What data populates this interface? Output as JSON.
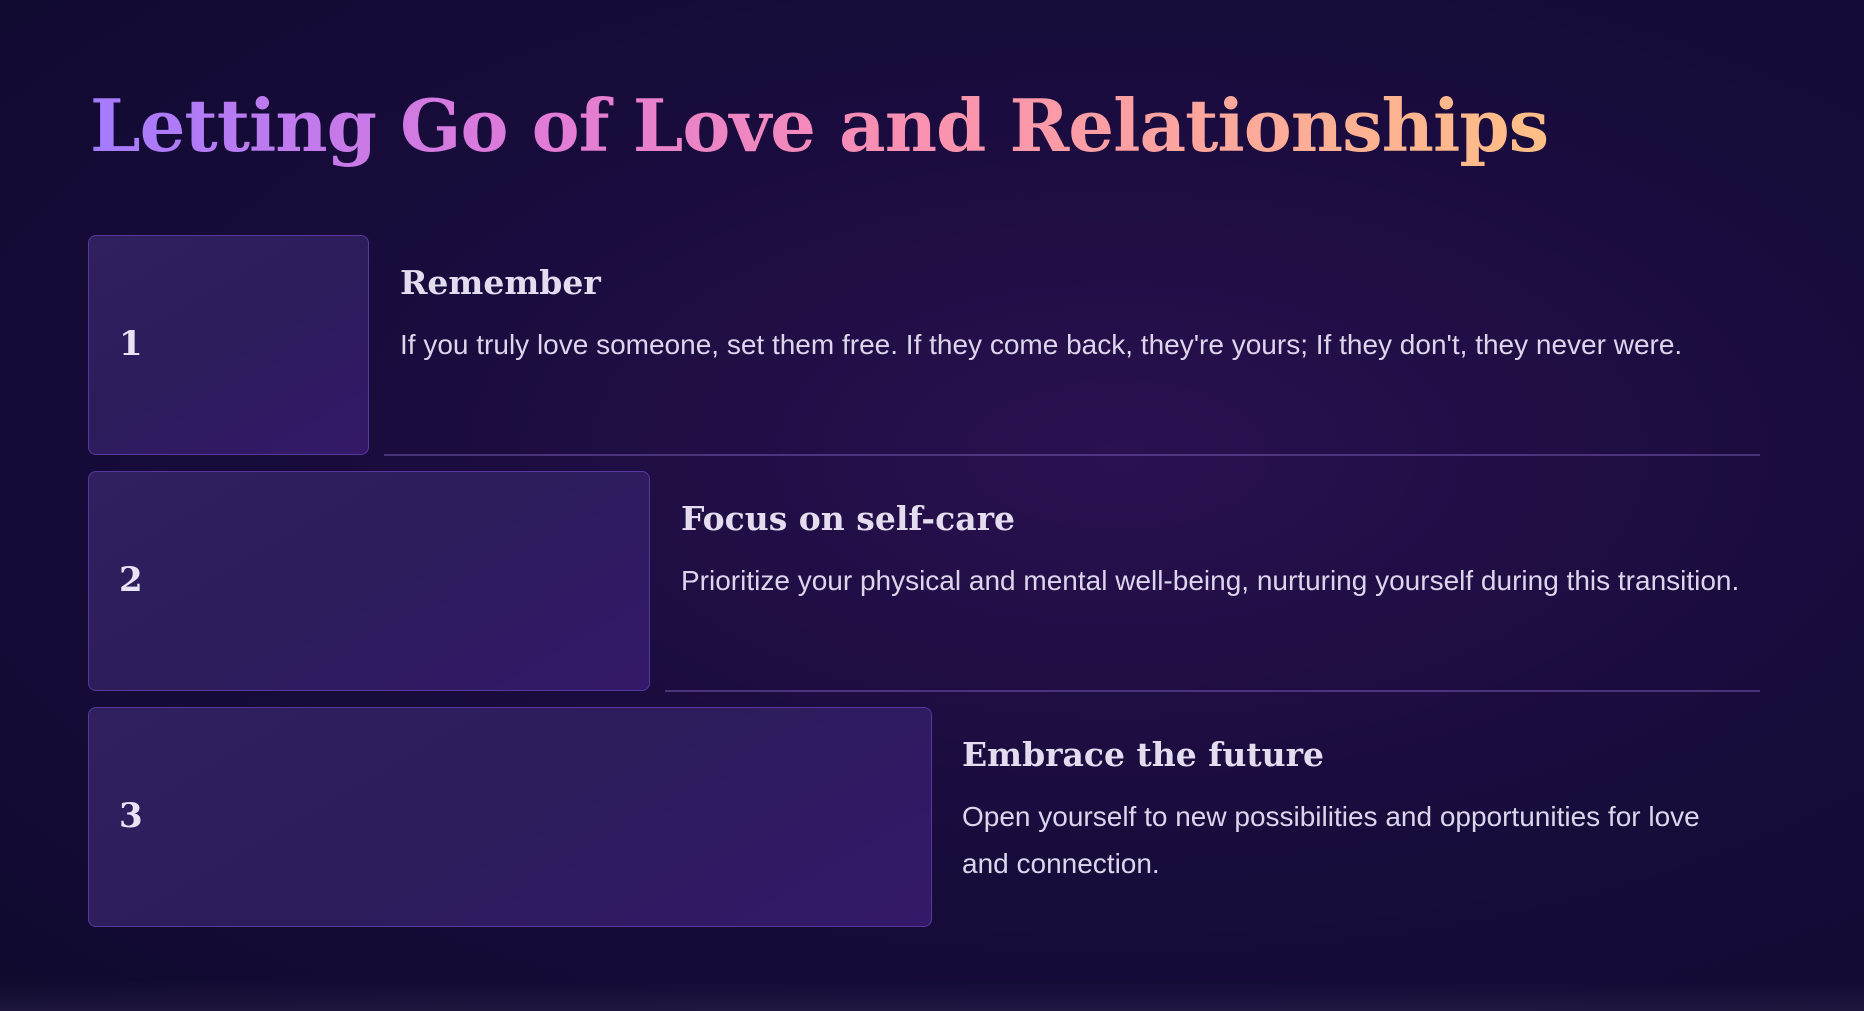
{
  "slide": {
    "title": "Letting Go of Love and Relationships",
    "steps": [
      {
        "number": "1",
        "heading": "Remember",
        "body": "If you truly love someone, set them free. If they come back, they're yours; If they don't, they never were."
      },
      {
        "number": "2",
        "heading": "Focus on self-care",
        "body": "Prioritize your physical and mental well-being, nurturing yourself during this transition."
      },
      {
        "number": "3",
        "heading": "Embrace the future",
        "body": "Open yourself to new possibilities and opportunities for love and connection."
      }
    ]
  },
  "colors": {
    "background": "#0f0a2e",
    "title_gradient": [
      "#a47bff",
      "#e07ad8",
      "#f98fb2",
      "#ffbf86"
    ],
    "box_fill": "#2e1e5e",
    "text": "#ddd5ec"
  }
}
